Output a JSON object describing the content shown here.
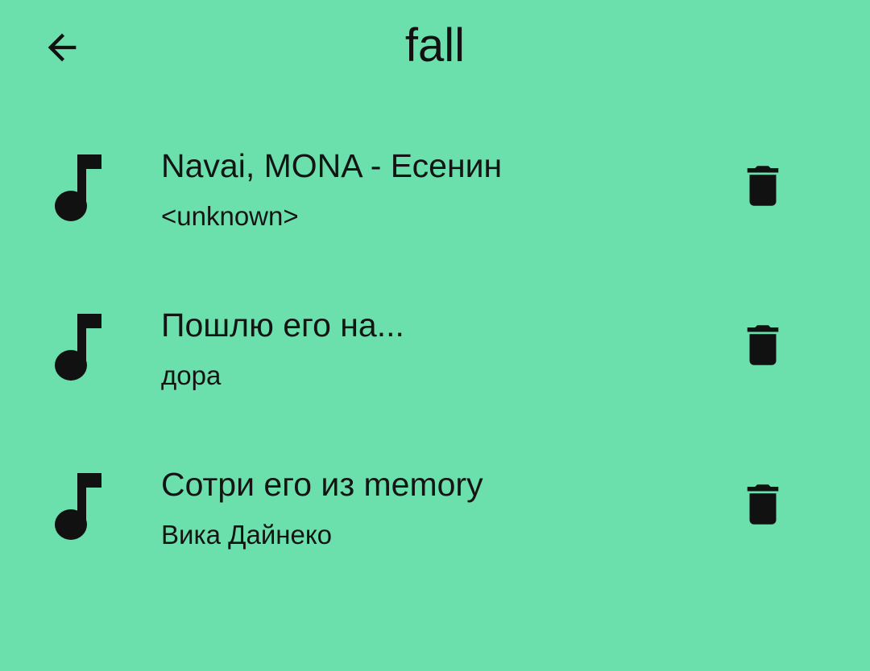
{
  "header": {
    "title": "fall",
    "back_icon": "arrow-back-icon"
  },
  "songs": [
    {
      "title": "Navai, MONA - Есенин",
      "artist": "<unknown>",
      "icon": "music-note-icon",
      "action_icon": "delete-icon"
    },
    {
      "title": "Пошлю его на...",
      "artist": "дора",
      "icon": "music-note-icon",
      "action_icon": "delete-icon"
    },
    {
      "title": "Сотри его из memory",
      "artist": "Вика Дайнеко",
      "icon": "music-note-icon",
      "action_icon": "delete-icon"
    }
  ],
  "colors": {
    "background": "#6ce0ac",
    "foreground": "#111111"
  }
}
